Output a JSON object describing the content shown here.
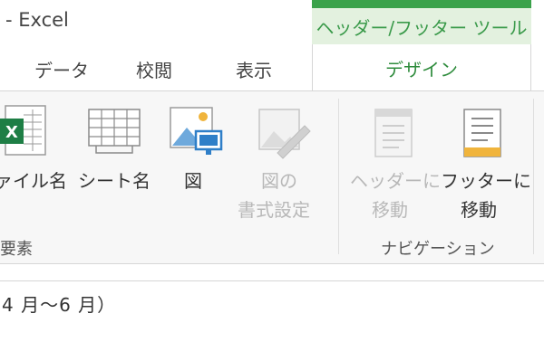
{
  "window": {
    "title": "- Excel"
  },
  "contextual_tab_group": {
    "label": "ヘッダー/フッター ツール",
    "color": "#3aa24a"
  },
  "tabs": [
    {
      "label": "データ"
    },
    {
      "label": "校閲"
    },
    {
      "label": "表示"
    },
    {
      "label": "デザイン",
      "active": true
    }
  ],
  "ribbon": {
    "groups": [
      {
        "label": "要素",
        "buttons": [
          {
            "label": "ァイル名",
            "icon": "excel-file-icon",
            "enabled": true
          },
          {
            "label": "シート名",
            "icon": "sheet-grid-icon",
            "enabled": true
          },
          {
            "label": "図",
            "icon": "picture-icon",
            "enabled": true
          },
          {
            "label_line1": "図の",
            "label_line2": "書式設定",
            "icon": "format-picture-icon",
            "enabled": false
          }
        ]
      },
      {
        "label": "ナビゲーション",
        "buttons": [
          {
            "label_line1": "ヘッダーに",
            "label_line2": "移動",
            "icon": "go-to-header-icon",
            "enabled": false
          },
          {
            "label_line1": "フッターに",
            "label_line2": "移動",
            "icon": "go-to-footer-icon",
            "enabled": true
          }
        ]
      }
    ]
  },
  "formula_bar": {
    "content": "4 月～6 月）"
  },
  "colors": {
    "accent": "#3aa24a",
    "active_tab_text": "#2f8c3d"
  }
}
